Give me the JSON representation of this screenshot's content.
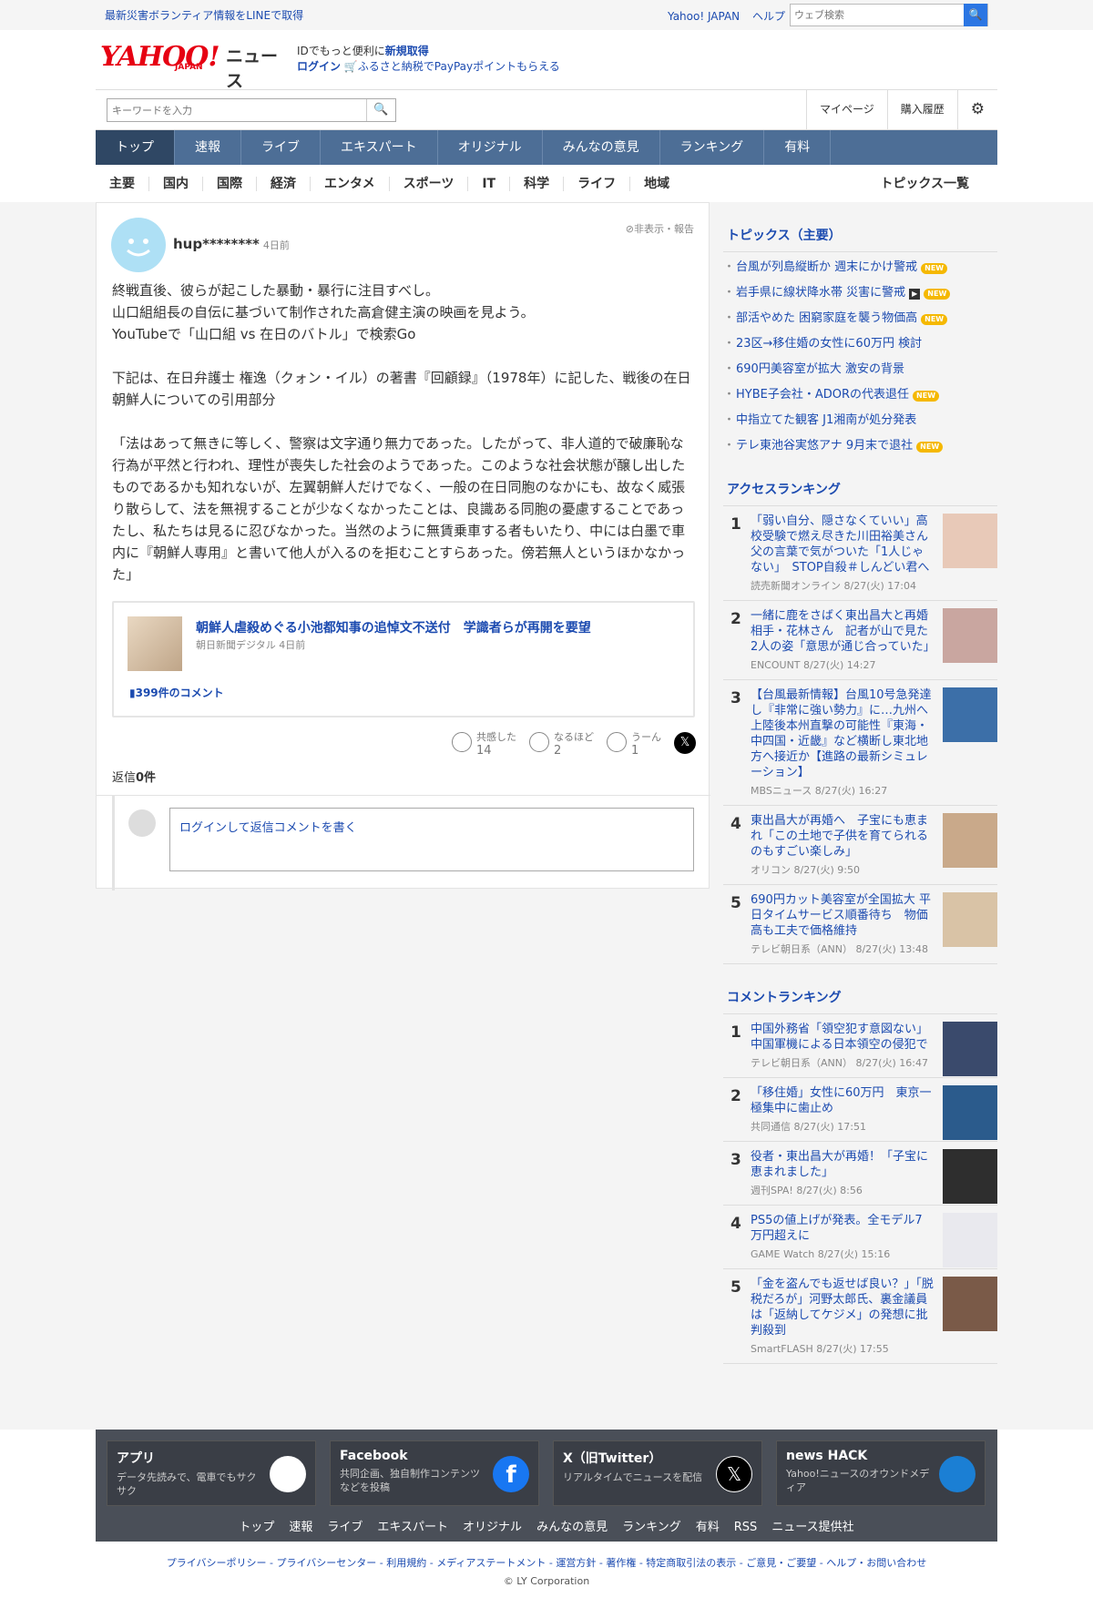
{
  "top": {
    "disaster": "最新災害ボランティア情報をLINEで取得",
    "yahoo_link": "Yahoo! JAPAN",
    "help_link": "ヘルプ",
    "web_search_placeholder": "ウェブ検索"
  },
  "logo": {
    "brand": "YAHOO!",
    "jp": "JAPAN",
    "news": "ニュース"
  },
  "idbox": {
    "line1_pre": "IDでもっと便利に",
    "line1_link": "新規取得",
    "login": "ログイン",
    "furusato": "ふるさと納税でPayPayポイントもらえる"
  },
  "search": {
    "placeholder": "キーワードを入力",
    "mypage": "マイページ",
    "history": "購入履歴"
  },
  "gnav": [
    "トップ",
    "速報",
    "ライブ",
    "エキスパート",
    "オリジナル",
    "みんなの意見",
    "ランキング",
    "有料"
  ],
  "snav": [
    "主要",
    "国内",
    "国際",
    "経済",
    "エンタメ",
    "スポーツ",
    "IT",
    "科学",
    "ライフ",
    "地域"
  ],
  "snav_all": "トピックス一覧",
  "comment": {
    "user": "hup********",
    "time": "4日前",
    "hide": "非表示・報告",
    "p1": [
      "終戦直後、彼らが起こした暴動・暴行に注目すべし。",
      "山口組組長の自伝に基づいて制作された高倉健主演の映画を見よう。",
      "YouTubeで「山口組 vs 在日のバトル」で検索Go"
    ],
    "p2": "下記は、在日弁護士 権逸（クォン・イル）の著書『回顧録』（1978年）に記した、戦後の在日朝鮮人についての引用部分",
    "p3": "「法はあって無きに等しく、警察は文字通り無力であった。したがって、非人道的で破廉恥な行為が平然と行われ、理性が喪失した社会のようであった。このような社会状態が醸し出したものであるかも知れないが、左翼朝鮮人だけでなく、一般の在日同胞のなかにも、故なく威張り散らして、法を無視することが少なくなかったことは、良識ある同胞の憂慮することであったし、私たちは見るに忍びなかった。当然のように無賃乗車する者もいたり、中には白墨で車内に『朝鮮人専用』と書いて他人が入るのを拒むことすらあった。傍若無人というほかなかった」"
  },
  "article": {
    "title": "朝鮮人虐殺めぐる小池都知事の追悼文不送付　学識者らが再開を要望",
    "source": "朝日新聞デジタル 4日前",
    "comments": "399件のコメント"
  },
  "reactions": [
    {
      "label": "共感した",
      "count": "14"
    },
    {
      "label": "なるほど",
      "count": "2"
    },
    {
      "label": "うーん",
      "count": "1"
    }
  ],
  "replies": {
    "pre": "返信",
    "count": "0件"
  },
  "reply_prompt": "ログインして返信コメントを書く",
  "topics": {
    "title": "トピックス（主要）",
    "items": [
      {
        "text": "台風が列島縦断か 週末にかけ警戒",
        "new": true,
        "video": false
      },
      {
        "text": "岩手県に線状降水帯 災害に警戒",
        "new": true,
        "video": true
      },
      {
        "text": "部活やめた 困窮家庭を襲う物価高",
        "new": true,
        "video": false
      },
      {
        "text": "23区→移住婚の女性に60万円 検討",
        "new": false,
        "video": false
      },
      {
        "text": "690円美容室が拡大 激安の背景",
        "new": false,
        "video": false
      },
      {
        "text": "HYBE子会社・ADORの代表退任",
        "new": true,
        "video": false
      },
      {
        "text": "中指立てた観客 J1湘南が処分発表",
        "new": false,
        "video": false
      },
      {
        "text": "テレ東池谷実悠アナ 9月末で退社",
        "new": true,
        "video": false
      }
    ],
    "new_label": "NEW"
  },
  "access_ranking": {
    "title": "アクセスランキング",
    "items": [
      {
        "no": "1",
        "title": "「弱い自分、隠さなくていい」高校受験で燃え尽きた川田裕美さん 父の言葉で気がついた「1人じゃない」　STOP自殺＃しんどい君へ",
        "meta": "読売新聞オンライン 8/27(火) 17:04"
      },
      {
        "no": "2",
        "title": "一緒に鹿をさばく東出昌大と再婚相手・花林さん　記者が山で見た2人の姿「意思が通じ合っていた」",
        "meta": "ENCOUNT 8/27(火) 14:27"
      },
      {
        "no": "3",
        "title": "【台風最新情報】台風10号急発達し『非常に強い勢力』に…九州へ上陸後本州直撃の可能性『東海・中四国・近畿』など横断し東北地方へ接近か【進路の最新シミュレーション】",
        "meta": "MBSニュース 8/27(火) 16:27"
      },
      {
        "no": "4",
        "title": "東出昌大が再婚へ　子宝にも恵まれ「この土地で子供を育てられるのもすごい楽しみ」",
        "meta": "オリコン 8/27(火) 9:50"
      },
      {
        "no": "5",
        "title": "690円カット美容室が全国拡大 平日タイムサービス順番待ち　物価高も工夫で価格維持",
        "meta": "テレビ朝日系（ANN） 8/27(火) 13:48"
      }
    ]
  },
  "comment_ranking": {
    "title": "コメントランキング",
    "items": [
      {
        "no": "1",
        "title": "中国外務省「領空犯す意図ない」 中国軍機による日本領空の侵犯で",
        "meta": "テレビ朝日系（ANN） 8/27(火) 16:47"
      },
      {
        "no": "2",
        "title": "「移住婚」女性に60万円　東京一極集中に歯止め",
        "meta": "共同通信 8/27(火) 17:51"
      },
      {
        "no": "3",
        "title": "役者・東出昌大が再婚！「子宝に恵まれました」",
        "meta": "週刊SPA! 8/27(火) 8:56"
      },
      {
        "no": "4",
        "title": "PS5の値上げが発表。全モデル7万円超えに",
        "meta": "GAME Watch 8/27(火) 15:16"
      },
      {
        "no": "5",
        "title": "「金を盗んでも返せば良い？」「脱税だろが」河野太郎氏、裏金議員は「返納してケジメ」の発想に批判殺到",
        "meta": "SmartFLASH 8/27(火) 17:55"
      }
    ]
  },
  "footer": {
    "boxes": [
      {
        "title": "アプリ",
        "desc": "データ先読みで、電車でもサクサク"
      },
      {
        "title": "Facebook",
        "desc": "共同企画、独自制作コンテンツなどを投稿"
      },
      {
        "title": "X（旧Twitter）",
        "desc": "リアルタイムでニュースを配信"
      },
      {
        "title": "news HACK",
        "desc": "Yahoo!ニュースのオウンドメディア"
      }
    ],
    "links": [
      "トップ",
      "速報",
      "ライブ",
      "エキスパート",
      "オリジナル",
      "みんなの意見",
      "ランキング",
      "有料",
      "RSS",
      "ニュース提供社"
    ]
  },
  "legal": "プライバシーポリシー - プライバシーセンター - 利用規約 - メディアステートメント - 運営方針 - 著作権 - 特定商取引法の表示 - ご意見・ご要望 - ヘルプ・お問い合わせ",
  "copyright": "© LY Corporation"
}
